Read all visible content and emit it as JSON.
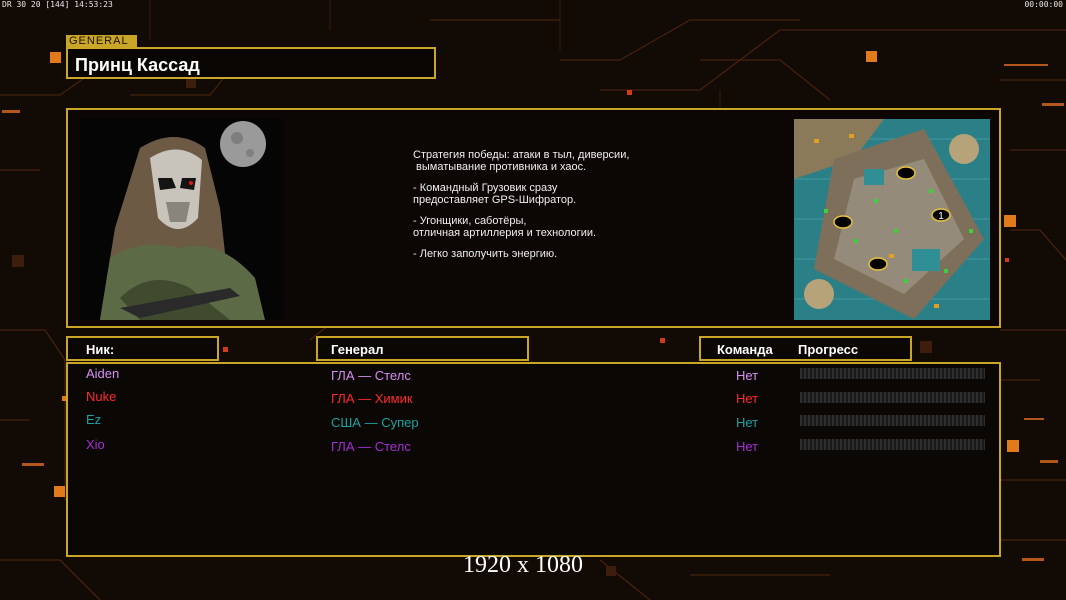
{
  "hud": {
    "left": "DR 30 20 [144] 14:53:23",
    "right": "00:00:00"
  },
  "general_tag": "GENERAL",
  "general_name": "Принц Кассад",
  "description": [
    "Стратегия победы: атаки в тыл, диверсии,",
    " выматывание противника и хаос.",
    "",
    "- Командный Грузовик сразу",
    "предоставляет GPS-Шифратор.",
    "",
    "- Угонщики, саботёры,",
    "отличная артиллерия и технологии.",
    "",
    "- Легко заполучить энергию."
  ],
  "columns": {
    "nick": "Ник:",
    "general": "Генерал",
    "team": "Команда",
    "progress": "Прогресс"
  },
  "players": [
    {
      "nick": "Aiden",
      "general": "ГЛА — Стелс",
      "team": "Нет",
      "color": "#d58ff5"
    },
    {
      "nick": "Nuke",
      "general": "ГЛА — Химик",
      "team": "Нет",
      "color": "#ff2a2a"
    },
    {
      "nick": "Ez",
      "general": "США — Супер",
      "team": "Нет",
      "color": "#1aa3a3"
    },
    {
      "nick": "Xio",
      "general": "ГЛА — Стелс",
      "team": "Нет",
      "color": "#a52dd6"
    }
  ],
  "resolution_label": "1920 x 1080",
  "colors": {
    "accent": "#c9a627",
    "background": "#120a05",
    "circuit": "#e07a1a"
  },
  "icons": {
    "portrait": "masked-general-portrait",
    "minimap": "map-preview"
  },
  "minimap_marker": "1"
}
